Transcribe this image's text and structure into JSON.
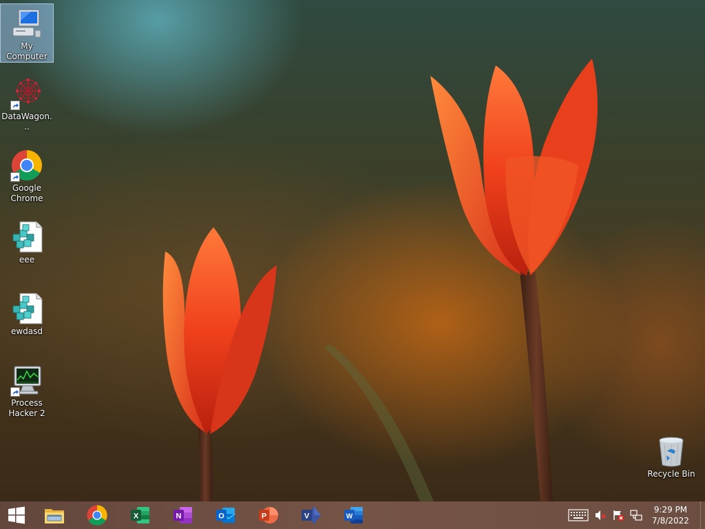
{
  "desktop": {
    "icons": [
      {
        "label": "My Computer",
        "icon": "computer-icon",
        "selected": true
      },
      {
        "label": "DataWagon...",
        "icon": "datawagon-icon"
      },
      {
        "label": "Google Chrome",
        "icon": "chrome-icon"
      },
      {
        "label": "eee",
        "icon": "registry-file-icon"
      },
      {
        "label": "ewdasd",
        "icon": "registry-file-icon"
      },
      {
        "label": "Process Hacker 2",
        "icon": "process-hacker-icon"
      },
      {
        "label": "Recycle Bin",
        "icon": "recycle-bin-icon"
      }
    ]
  },
  "taskbar": {
    "pinned": [
      {
        "app": "File Explorer",
        "icon": "file-explorer-icon",
        "color": "#f2c94c"
      },
      {
        "app": "Google Chrome",
        "icon": "chrome-icon",
        "color": "#4285f4"
      },
      {
        "app": "Excel",
        "icon": "excel-icon",
        "color": "#1e7145",
        "letter": "X"
      },
      {
        "app": "OneNote",
        "icon": "onenote-icon",
        "color": "#7719aa",
        "letter": "N"
      },
      {
        "app": "Outlook",
        "icon": "outlook-icon",
        "color": "#0a64c8",
        "letter": "O"
      },
      {
        "app": "PowerPoint",
        "icon": "powerpoint-icon",
        "color": "#d24726",
        "letter": "P"
      },
      {
        "app": "Visio",
        "icon": "visio-icon",
        "color": "#3955a3",
        "letter": "V"
      },
      {
        "app": "Word",
        "icon": "word-icon",
        "color": "#2b579a",
        "letter": "W"
      }
    ],
    "tray": {
      "icons": [
        "keyboard-icon",
        "volume-muted-icon",
        "action-center-flag-icon",
        "network-icon"
      ]
    },
    "clock": {
      "time": "9:29 PM",
      "date": "7/8/2022"
    }
  }
}
